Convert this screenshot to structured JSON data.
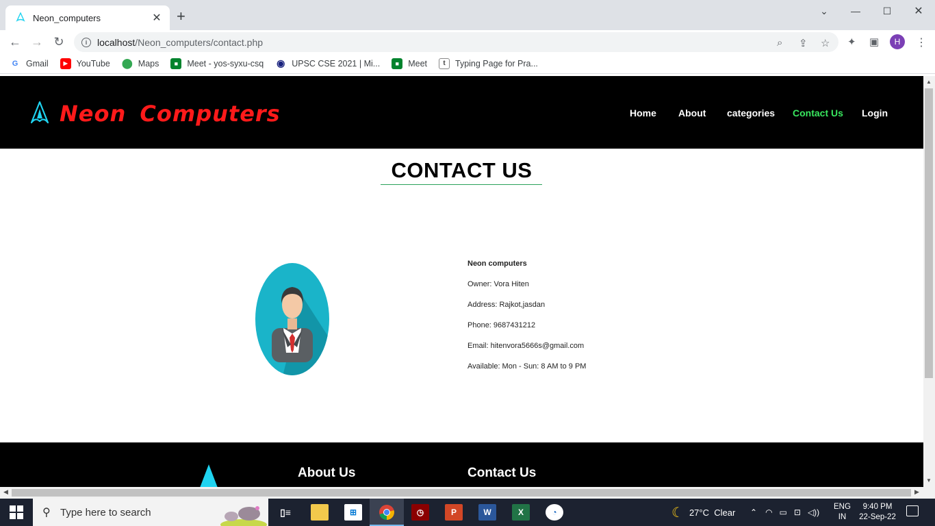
{
  "browser": {
    "tab_title": "Neon_computers",
    "url_host": "localhost",
    "url_path": "/Neon_computers/contact.php",
    "profile_initial": "H",
    "bookmarks": [
      {
        "label": "Gmail",
        "icon": "gmail-icon"
      },
      {
        "label": "YouTube",
        "icon": "youtube-icon"
      },
      {
        "label": "Maps",
        "icon": "maps-icon"
      },
      {
        "label": "Meet - yos-syxu-csq",
        "icon": "meet-icon"
      },
      {
        "label": "UPSC CSE 2021 | Mi...",
        "icon": "upsc-icon"
      },
      {
        "label": "Meet",
        "icon": "meet-icon"
      },
      {
        "label": "Typing Page for Pra...",
        "icon": "typing-icon"
      }
    ]
  },
  "site": {
    "brand": "Neon Computers",
    "nav": {
      "home": "Home",
      "about": "About",
      "categories": "categories",
      "contact": "Contact Us",
      "login": "Login"
    },
    "page_title": "CONTACT US",
    "contact": {
      "company": "Neon computers",
      "owner": "Owner: Vora Hiten",
      "address": "Address: Rajkot,jasdan",
      "phone": "Phone: 9687431212",
      "email": "Email: hitenvora5666s@gmail.com",
      "available": "Available: Mon - Sun: 8 AM to 9 PM"
    },
    "footer": {
      "about_heading": "About Us",
      "contact_heading": "Contact Us"
    }
  },
  "taskbar": {
    "search_placeholder": "Type here to search",
    "weather": "27°C  Clear",
    "lang_top": "ENG",
    "lang_bottom": "IN",
    "time": "9:40 PM",
    "date": "22-Sep-22"
  },
  "colors": {
    "brand_red": "#ff1a1a",
    "nav_active": "#39e75f",
    "logo_cyan": "#1fd3f0",
    "avatar_bg": "#1ab4c9"
  }
}
